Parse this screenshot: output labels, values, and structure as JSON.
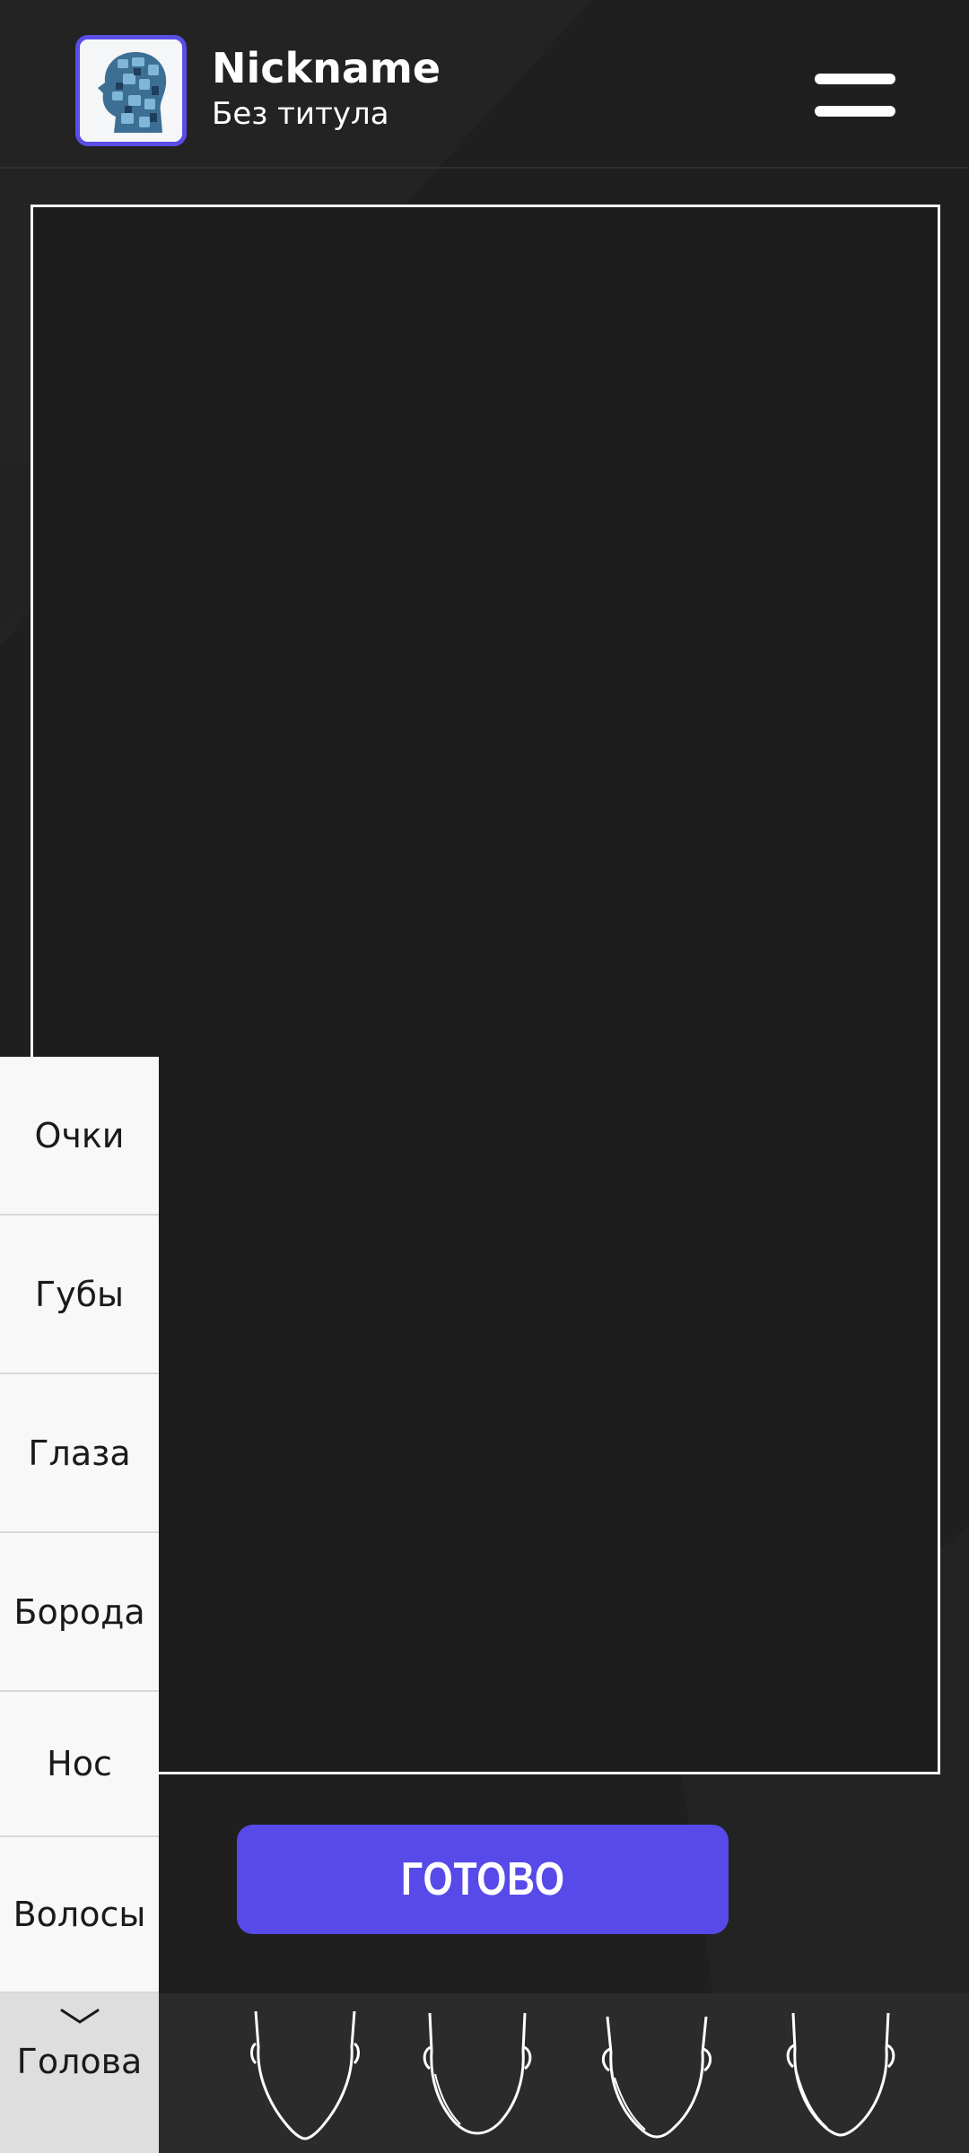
{
  "header": {
    "nickname": "Nickname",
    "title": "Без титула",
    "avatar_icon": "puzzle-head-avatar-icon",
    "menu_icon": "hamburger-menu-icon"
  },
  "categories": {
    "items": [
      {
        "label": "Очки"
      },
      {
        "label": "Губы"
      },
      {
        "label": "Глаза"
      },
      {
        "label": "Борода"
      },
      {
        "label": "Нос"
      },
      {
        "label": "Волосы"
      }
    ],
    "active": {
      "label": "Голова",
      "icon": "chevron-down-icon"
    }
  },
  "done_button": {
    "label": "ГОТОВО"
  },
  "head_options": [
    {
      "icon": "head-shape-option-1-icon"
    },
    {
      "icon": "head-shape-option-2-icon"
    },
    {
      "icon": "head-shape-option-3-icon"
    },
    {
      "icon": "head-shape-option-4-icon"
    }
  ],
  "colors": {
    "background": "#1f1f1f",
    "accent": "#574ae8",
    "panel": "#f8f8f8",
    "panel_active": "#dedede",
    "strip": "#2b2b2b"
  }
}
